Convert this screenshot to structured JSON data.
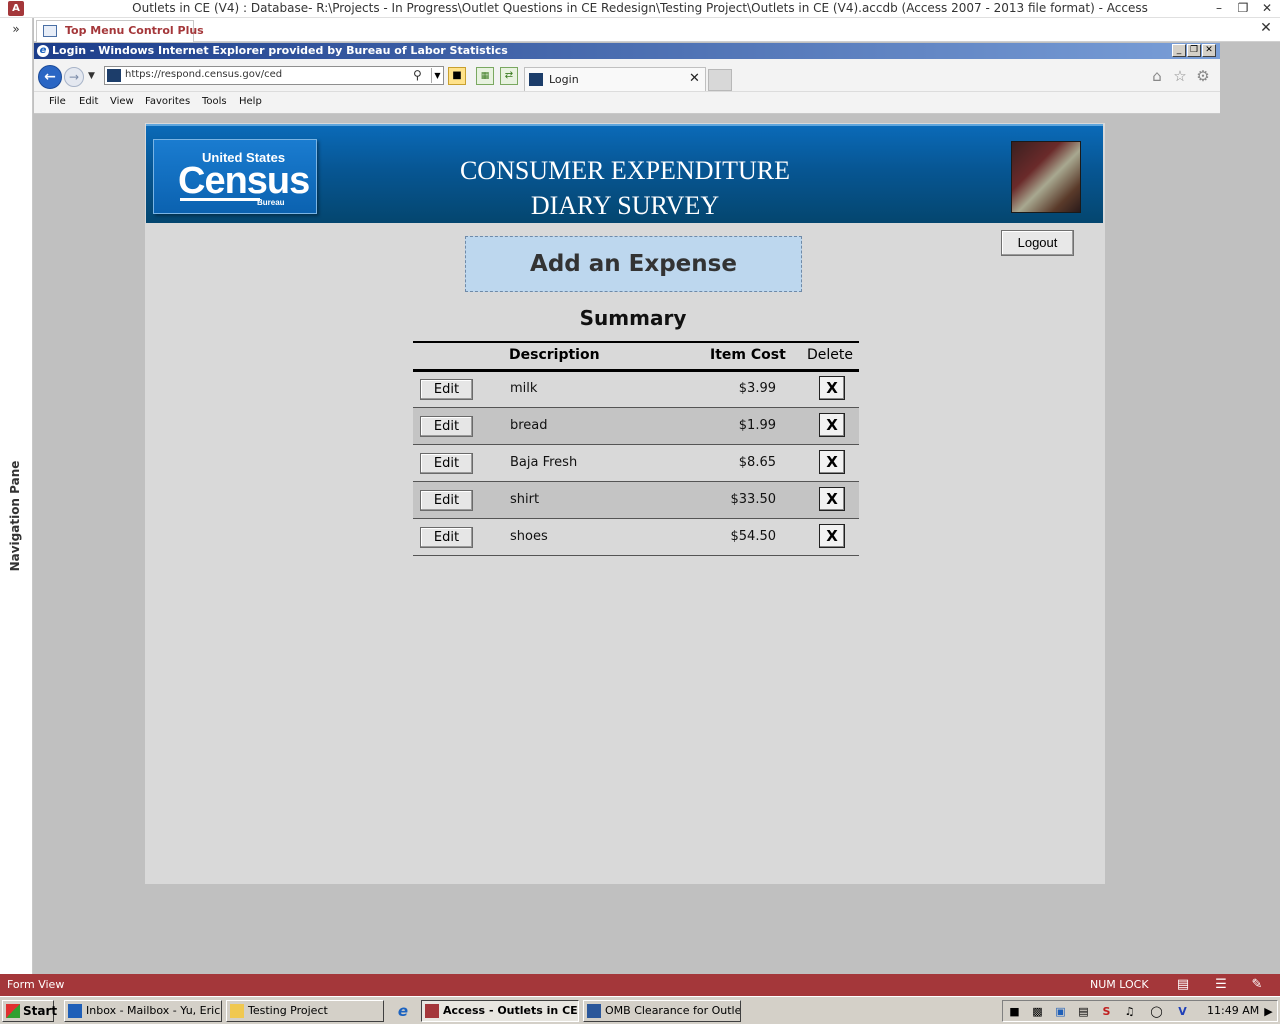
{
  "access": {
    "window_title": "Outlets in CE (V4) : Database- R:\\Projects - In Progress\\Outlet Questions in CE Redesign\\Testing Project\\Outlets in CE (V4).accdb (Access 2007 - 2013 file format) - Access",
    "app_icon": "A",
    "nav_pane_label": "Navigation Pane",
    "object_tab_label": "Top Menu Control Plus",
    "status_text": "Form View",
    "num_lock": "NUM LOCK"
  },
  "ie": {
    "window_title": "Login - Windows Internet Explorer provided by Bureau of Labor Statistics",
    "url": "https://respond.census.gov/ced",
    "tab_label": "Login",
    "menu": [
      "File",
      "Edit",
      "View",
      "Favorites",
      "Tools",
      "Help"
    ]
  },
  "banner": {
    "logo_top": "United States",
    "logo_word": "Census",
    "logo_bottom": "Bureau",
    "title_line1": "CONSUMER EXPENDITURE",
    "title_line2": "DIARY SURVEY"
  },
  "form": {
    "logout_label": "Logout",
    "add_expense_label": "Add an Expense",
    "summary_title": "Summary",
    "columns": {
      "description": "Description",
      "cost": "Item Cost",
      "delete": "Delete"
    },
    "edit_label": "Edit",
    "delete_label": "X",
    "rows": [
      {
        "description": "milk",
        "cost": "$3.99"
      },
      {
        "description": "bread",
        "cost": "$1.99"
      },
      {
        "description": "Baja Fresh",
        "cost": "$8.65"
      },
      {
        "description": "shirt",
        "cost": "$33.50"
      },
      {
        "description": "shoes",
        "cost": "$54.50"
      }
    ]
  },
  "taskbar": {
    "start_label": "Start",
    "tasks": [
      "Inbox - Mailbox - Yu, Eric...",
      "Testing Project",
      "Access - Outlets in CE ...",
      "OMB Clearance for Outle..."
    ],
    "clock": "11:49 AM"
  },
  "colors": {
    "access_accent": "#a4373a",
    "banner_blue": "#075693",
    "add_button_fill": "#bdd7ee"
  }
}
